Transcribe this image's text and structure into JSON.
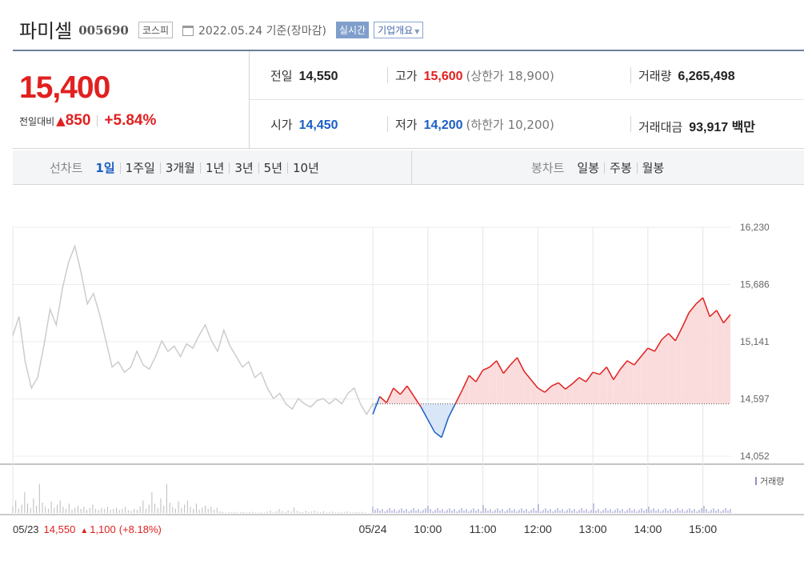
{
  "header": {
    "name": "파미셀",
    "code": "005690",
    "market": "코스피",
    "date": "2022.05.24 기준(장마감)",
    "realtime": "실시간",
    "info": "기업개요"
  },
  "quote": {
    "price": "15,400",
    "compare_label": "전일대비",
    "change_arrow": "▲",
    "change": "850",
    "percent": "+5.84%",
    "prev_label": "전일",
    "prev": "14,550",
    "high_label": "고가",
    "high": "15,600",
    "upper_limit": "(상한가 18,900)",
    "volume_label": "거래량",
    "volume": "6,265,498",
    "open_label": "시가",
    "open": "14,450",
    "low_label": "저가",
    "low": "14,200",
    "lower_limit": "(하한가 10,200)",
    "amount_label": "거래대금",
    "amount": "93,917 백만"
  },
  "tabs": {
    "line_label": "선차트",
    "line_items": [
      "1일",
      "1주일",
      "3개월",
      "1년",
      "3년",
      "5년",
      "10년"
    ],
    "candle_label": "봉차트",
    "candle_items": [
      "일봉",
      "주봉",
      "월봉"
    ]
  },
  "colors": {
    "up": "#e12020",
    "down": "#1a5fc4",
    "prev_line": "#cccccc",
    "up_fill": "#fbdcdc",
    "down_fill": "#d9e6f7"
  },
  "chart_data": {
    "type": "line",
    "yticks": [
      "16,230",
      "15,686",
      "15,141",
      "14,597",
      "14,052"
    ],
    "xticks": [
      "05/23",
      "05/24",
      "10:00",
      "11:00",
      "12:00",
      "13:00",
      "14:00",
      "15:00"
    ],
    "ylim": [
      14052,
      16230
    ],
    "prev_close": 14550,
    "volume_label": "거래량",
    "prev_day_label": "05/23",
    "prev_day_price": "14,550",
    "prev_day_arrow": "▲",
    "prev_day_change": "1,100",
    "prev_day_pct": "(+8.18%)",
    "series": [
      {
        "day": "05/23",
        "values": [
          15200,
          15380,
          14950,
          14700,
          14800,
          15100,
          15450,
          15300,
          15650,
          15900,
          16050,
          15800,
          15500,
          15600,
          15400,
          15150,
          14900,
          14950,
          14850,
          14900,
          15050,
          14920,
          14880,
          15000,
          15150,
          15050,
          15100,
          15000,
          15120,
          15080,
          15200,
          15300,
          15150,
          15050,
          15250,
          15100,
          15000,
          14900,
          14950,
          14800,
          14850,
          14700,
          14600,
          14650,
          14550,
          14500,
          14600,
          14550,
          14520,
          14580,
          14600,
          14550,
          14600,
          14550,
          14650,
          14700,
          14550,
          14450,
          14550
        ]
      },
      {
        "day": "05/24",
        "values": [
          14450,
          14620,
          14560,
          14700,
          14640,
          14720,
          14620,
          14520,
          14400,
          14280,
          14230,
          14420,
          14550,
          14680,
          14820,
          14760,
          14870,
          14900,
          14960,
          14840,
          14920,
          14990,
          14860,
          14780,
          14700,
          14660,
          14720,
          14750,
          14690,
          14740,
          14800,
          14760,
          14850,
          14830,
          14900,
          14780,
          14880,
          14960,
          14920,
          15000,
          15080,
          15050,
          15160,
          15220,
          15150,
          15280,
          15420,
          15500,
          15560,
          15380,
          15440,
          15320,
          15400
        ]
      }
    ]
  }
}
